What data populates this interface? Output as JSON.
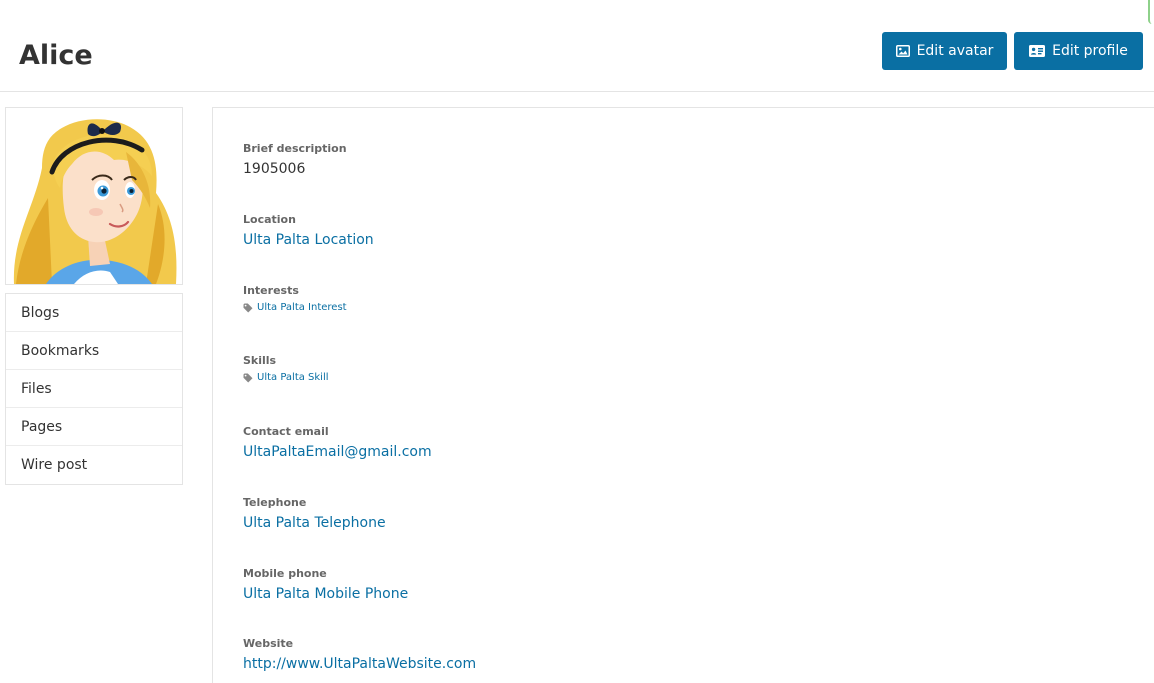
{
  "header": {
    "title": "Alice",
    "edit_avatar_label": "Edit avatar",
    "edit_profile_label": "Edit profile"
  },
  "sidebar": {
    "items": [
      {
        "label": "Blogs"
      },
      {
        "label": "Bookmarks"
      },
      {
        "label": "Files"
      },
      {
        "label": "Pages"
      },
      {
        "label": "Wire post"
      }
    ]
  },
  "profile": {
    "brief_description": {
      "label": "Brief description",
      "value": "1905006"
    },
    "location": {
      "label": "Location",
      "value": "Ulta Palta Location"
    },
    "interests": {
      "label": "Interests",
      "tag": "Ulta Palta Interest",
      "icon": "tag-icon"
    },
    "skills": {
      "label": "Skills",
      "tag": "Ulta Palta Skill",
      "icon": "tag-icon"
    },
    "contact_email": {
      "label": "Contact email",
      "value": "UltaPaltaEmail@gmail.com"
    },
    "telephone": {
      "label": "Telephone",
      "value": "Ulta Palta Telephone"
    },
    "mobile_phone": {
      "label": "Mobile phone",
      "value": "Ulta Palta Mobile Phone"
    },
    "website": {
      "label": "Website",
      "value": "http://www.UltaPaltaWebsite.com"
    }
  },
  "icons": {
    "edit_avatar": "image-icon",
    "edit_profile": "id-card-icon"
  },
  "colors": {
    "accent": "#0a6fa3",
    "border": "#e4e4e4",
    "label": "#666666",
    "text": "#333333"
  }
}
